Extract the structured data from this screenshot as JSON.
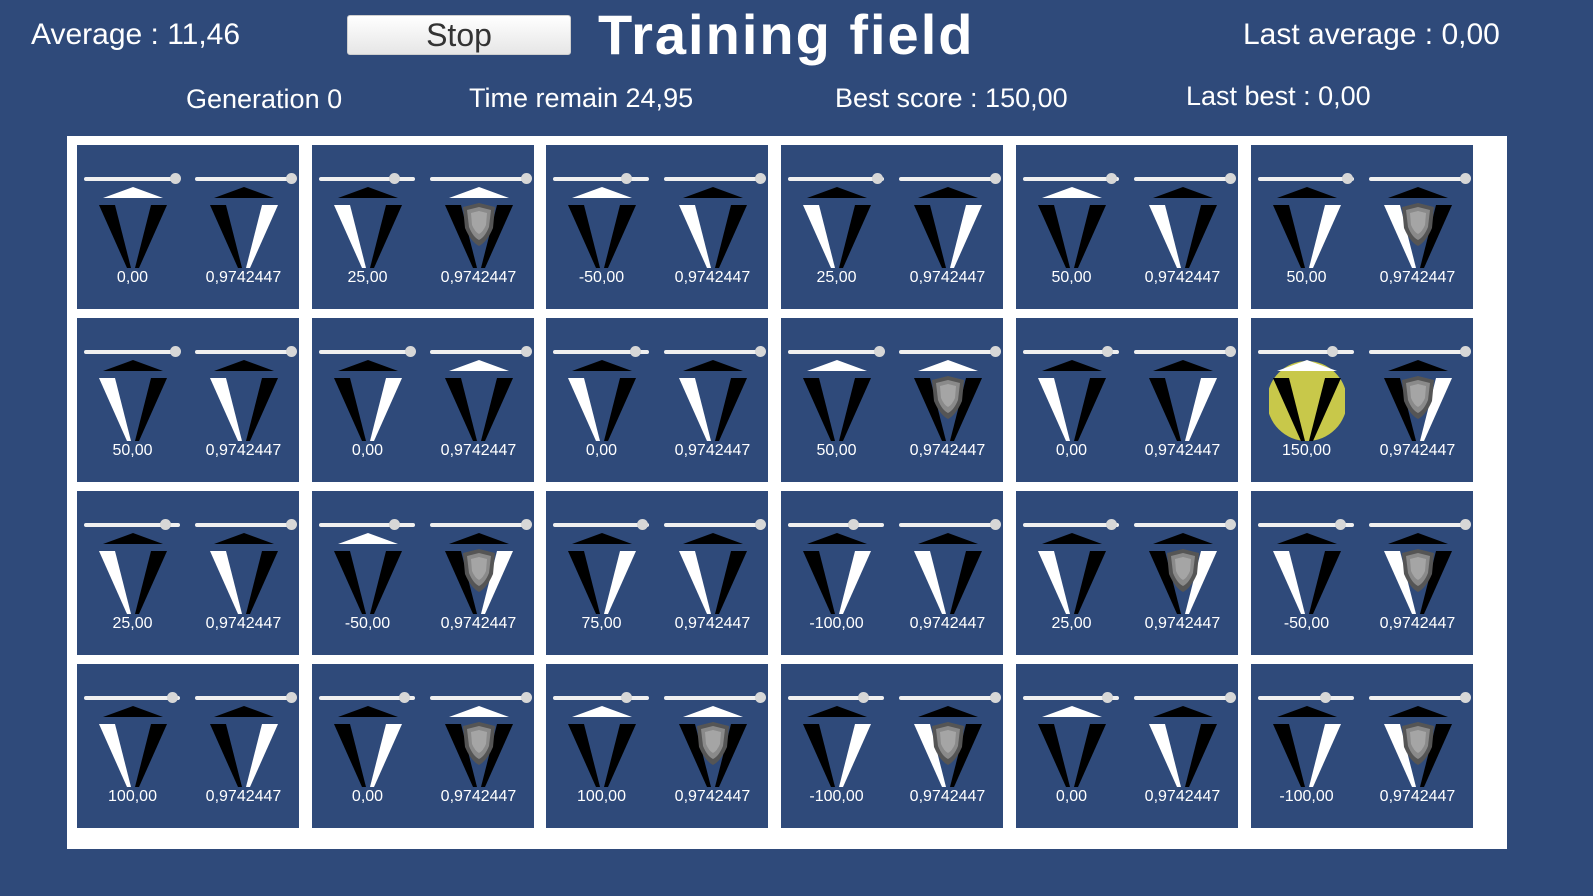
{
  "header": {
    "average": "Average : 11,46",
    "stop_label": "Stop",
    "title": "Training field",
    "last_average": "Last average :  0,00",
    "generation": "Generation 0",
    "time_remain": "Time remain 24,95",
    "best_score": "Best score : 150,00",
    "last_best": "Last best : 0,00"
  },
  "colors": {
    "background": "#2f4a7a",
    "board_border": "#ffffff",
    "highlight": "#c8c84a",
    "shield": "#8a8a8a"
  },
  "cells": [
    {
      "score": "0,00",
      "score_slider": 0.95,
      "score_light": "top",
      "value": "0,9742447",
      "value_slider": 1.0,
      "value_light": "right",
      "shield": false,
      "highlight": false
    },
    {
      "score": "25,00",
      "score_slider": 0.78,
      "score_light": "left",
      "value": "0,9742447",
      "value_slider": 1.0,
      "value_light": "top",
      "shield": true,
      "highlight": false
    },
    {
      "score": "-50,00",
      "score_slider": 0.76,
      "score_light": "top",
      "value": "0,9742447",
      "value_slider": 1.0,
      "value_light": "left",
      "shield": false,
      "highlight": false
    },
    {
      "score": "25,00",
      "score_slider": 0.93,
      "score_light": "left",
      "value": "0,9742447",
      "value_slider": 1.0,
      "value_light": "right",
      "shield": false,
      "highlight": false
    },
    {
      "score": "50,00",
      "score_slider": 0.92,
      "score_light": "top",
      "value": "0,9742447",
      "value_slider": 1.0,
      "value_light": "left",
      "shield": false,
      "highlight": false
    },
    {
      "score": "50,00",
      "score_slider": 0.93,
      "score_light": "right",
      "value": "0,9742447",
      "value_slider": 1.0,
      "value_light": "left",
      "shield": true,
      "highlight": false
    },
    {
      "score": "50,00",
      "score_slider": 0.95,
      "score_light": "left",
      "value": "0,9742447",
      "value_slider": 1.0,
      "value_light": "left",
      "shield": false,
      "highlight": false
    },
    {
      "score": "0,00",
      "score_slider": 0.95,
      "score_light": "right",
      "value": "0,9742447",
      "value_slider": 1.0,
      "value_light": "top",
      "shield": false,
      "highlight": false
    },
    {
      "score": "0,00",
      "score_slider": 0.85,
      "score_light": "left",
      "value": "0,9742447",
      "value_slider": 1.0,
      "value_light": "left",
      "shield": false,
      "highlight": false
    },
    {
      "score": "50,00",
      "score_slider": 0.95,
      "score_light": "top",
      "value": "0,9742447",
      "value_slider": 1.0,
      "value_light": "top",
      "shield": true,
      "highlight": false
    },
    {
      "score": "0,00",
      "score_slider": 0.87,
      "score_light": "left",
      "value": "0,9742447",
      "value_slider": 1.0,
      "value_light": "right",
      "shield": false,
      "highlight": false
    },
    {
      "score": "150,00",
      "score_slider": 0.77,
      "score_light": "top",
      "value": "0,9742447",
      "value_slider": 1.0,
      "value_light": "right",
      "shield": true,
      "highlight": true
    },
    {
      "score": "25,00",
      "score_slider": 0.84,
      "score_light": "left",
      "value": "0,9742447",
      "value_slider": 1.0,
      "value_light": "left",
      "shield": false,
      "highlight": false
    },
    {
      "score": "-50,00",
      "score_slider": 0.78,
      "score_light": "top",
      "value": "0,9742447",
      "value_slider": 1.0,
      "value_light": "right",
      "shield": true,
      "highlight": false
    },
    {
      "score": "75,00",
      "score_slider": 0.93,
      "score_light": "right",
      "value": "0,9742447",
      "value_slider": 1.0,
      "value_light": "left",
      "shield": false,
      "highlight": false
    },
    {
      "score": "-100,00",
      "score_slider": 0.68,
      "score_light": "right",
      "value": "0,9742447",
      "value_slider": 1.0,
      "value_light": "left",
      "shield": false,
      "highlight": false
    },
    {
      "score": "25,00",
      "score_slider": 0.92,
      "score_light": "left",
      "value": "0,9742447",
      "value_slider": 1.0,
      "value_light": "right",
      "shield": true,
      "highlight": false
    },
    {
      "score": "-50,00",
      "score_slider": 0.85,
      "score_light": "left",
      "value": "0,9742447",
      "value_slider": 1.0,
      "value_light": "left",
      "shield": true,
      "highlight": false
    },
    {
      "score": "100,00",
      "score_slider": 0.92,
      "score_light": "left",
      "value": "0,9742447",
      "value_slider": 1.0,
      "value_light": "right",
      "shield": false,
      "highlight": false
    },
    {
      "score": "0,00",
      "score_slider": 0.89,
      "score_light": "right",
      "value": "0,9742447",
      "value_slider": 1.0,
      "value_light": "top",
      "shield": true,
      "highlight": false
    },
    {
      "score": "100,00",
      "score_slider": 0.76,
      "score_light": "top",
      "value": "0,9742447",
      "value_slider": 1.0,
      "value_light": "top",
      "shield": true,
      "highlight": false
    },
    {
      "score": "-100,00",
      "score_slider": 0.78,
      "score_light": "right",
      "value": "0,9742447",
      "value_slider": 1.0,
      "value_light": "left",
      "shield": true,
      "highlight": false
    },
    {
      "score": "0,00",
      "score_slider": 0.87,
      "score_light": "top",
      "value": "0,9742447",
      "value_slider": 1.0,
      "value_light": "left",
      "shield": false,
      "highlight": false
    },
    {
      "score": "-100,00",
      "score_slider": 0.7,
      "score_light": "right",
      "value": "0,9742447",
      "value_slider": 1.0,
      "value_light": "left",
      "shield": true,
      "highlight": false
    }
  ]
}
